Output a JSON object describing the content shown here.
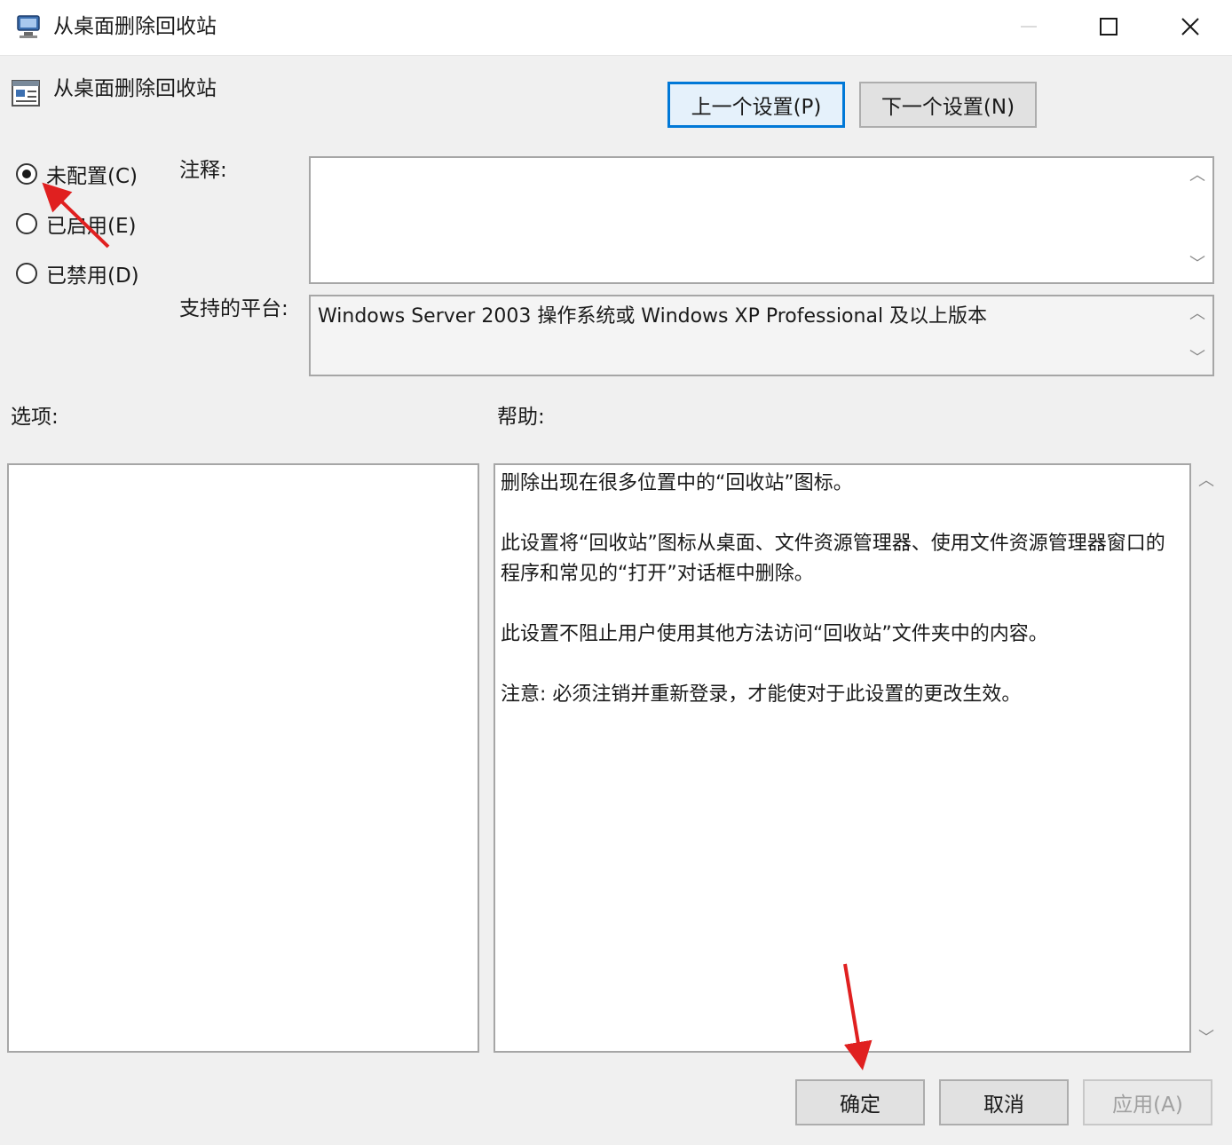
{
  "window": {
    "title": "从桌面删除回收站",
    "controls": {
      "minimize": "minimize",
      "maximize": "maximize",
      "close": "close"
    }
  },
  "header": {
    "policy_title": "从桌面删除回收站",
    "prev_button": "上一个设置(P)",
    "next_button": "下一个设置(N)"
  },
  "state": {
    "options": [
      {
        "label": "未配置(C)",
        "checked": true
      },
      {
        "label": "已启用(E)",
        "checked": false
      },
      {
        "label": "已禁用(D)",
        "checked": false
      }
    ]
  },
  "comment": {
    "label": "注释:",
    "value": ""
  },
  "platform": {
    "label": "支持的平台:",
    "value": "Windows Server 2003 操作系统或 Windows XP Professional 及以上版本"
  },
  "options_panel": {
    "label": "选项:"
  },
  "help_panel": {
    "label": "帮助:",
    "paragraphs": [
      "删除出现在很多位置中的“回收站”图标。",
      "此设置将“回收站”图标从桌面、文件资源管理器、使用文件资源管理器窗口的程序和常见的“打开”对话框中删除。",
      "此设置不阻止用户使用其他方法访问“回收站”文件夹中的内容。",
      "注意: 必须注销并重新登录，才能使对于此设置的更改生效。"
    ]
  },
  "footer": {
    "ok_button": "确定",
    "cancel_button": "取消",
    "apply_button": "应用(A)"
  },
  "annotation": {
    "arrow_color": "#e02020"
  }
}
